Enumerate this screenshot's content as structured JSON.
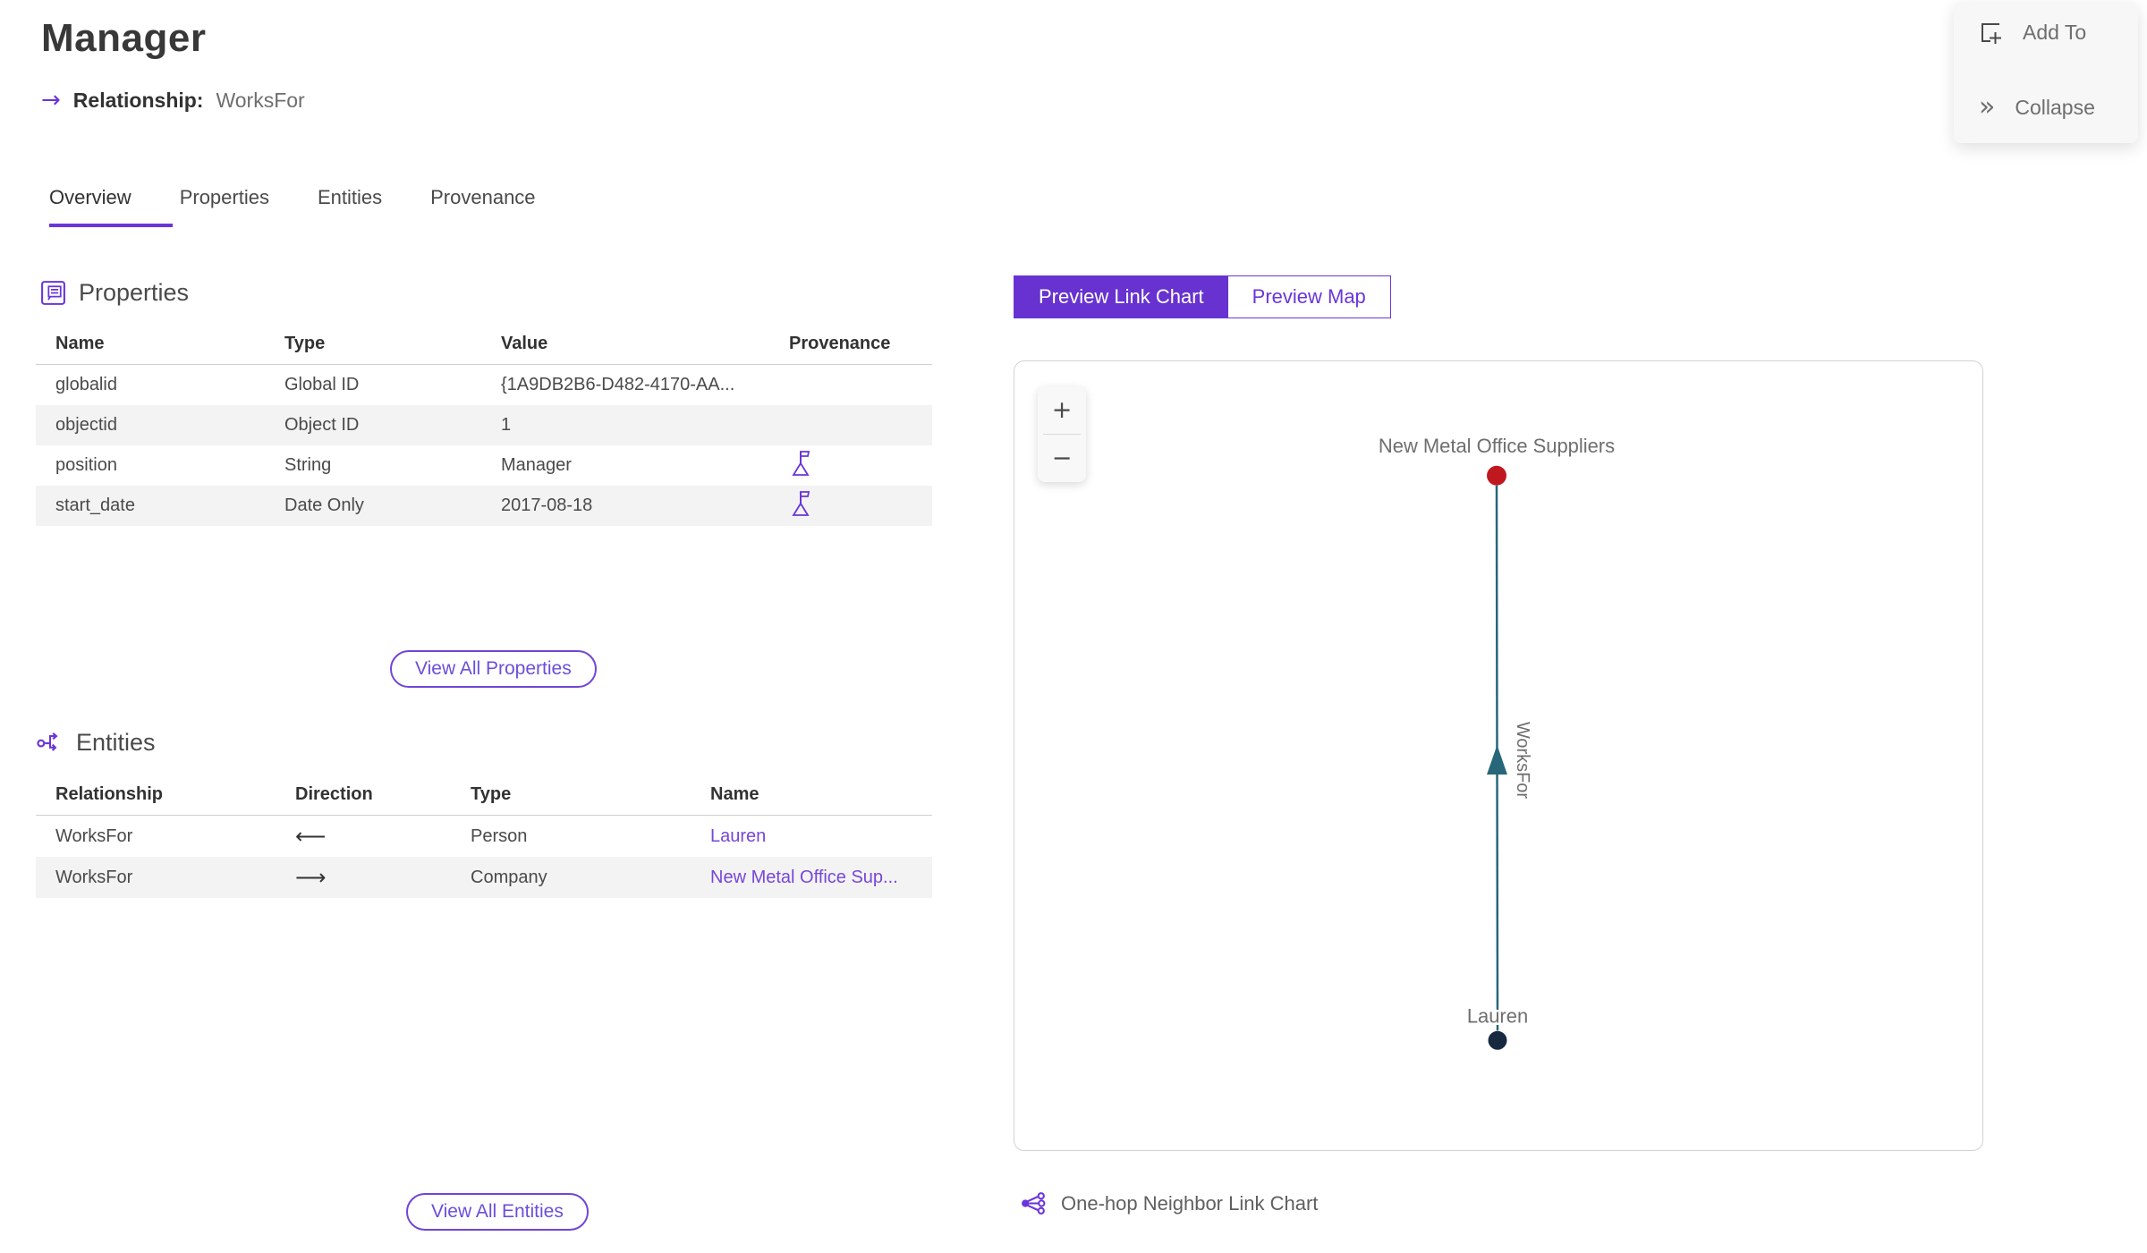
{
  "header": {
    "title": "Manager",
    "relationship_arrow": "→",
    "relationship_label": "Relationship:",
    "relationship_value": "WorksFor"
  },
  "actions": {
    "add_to_label": "Add To",
    "collapse_label": "Collapse",
    "collapse_glyph": "»"
  },
  "tabs": [
    {
      "label": "Overview",
      "active": true
    },
    {
      "label": "Properties",
      "active": false
    },
    {
      "label": "Entities",
      "active": false
    },
    {
      "label": "Provenance",
      "active": false
    }
  ],
  "properties": {
    "section_title": "Properties",
    "columns": {
      "name": "Name",
      "type": "Type",
      "value": "Value",
      "provenance": "Provenance"
    },
    "rows": [
      {
        "name": "globalid",
        "type": "Global ID",
        "value": "{1A9DB2B6-D482-4170-AA...",
        "provenance": false
      },
      {
        "name": "objectid",
        "type": "Object ID",
        "value": "1",
        "provenance": false
      },
      {
        "name": "position",
        "type": "String",
        "value": "Manager",
        "provenance": true
      },
      {
        "name": "start_date",
        "type": "Date Only",
        "value": "2017-08-18",
        "provenance": true
      }
    ],
    "view_all_label": "View All Properties"
  },
  "entities": {
    "section_title": "Entities",
    "columns": {
      "relationship": "Relationship",
      "direction": "Direction",
      "type": "Type",
      "name": "Name"
    },
    "rows": [
      {
        "relationship": "WorksFor",
        "direction_glyph": "⟵",
        "direction": "incoming",
        "type": "Person",
        "name": "Lauren"
      },
      {
        "relationship": "WorksFor",
        "direction_glyph": "⟶",
        "direction": "outgoing",
        "type": "Company",
        "name": "New Metal Office Sup..."
      }
    ],
    "view_all_label": "View All Entities"
  },
  "preview": {
    "link_chart_label": "Preview Link Chart",
    "map_label": "Preview Map",
    "zoom_in": "+",
    "zoom_out": "−",
    "caption": "One-hop Neighbor Link Chart"
  },
  "link_chart": {
    "type": "link-chart",
    "nodes": [
      {
        "label": "New Metal Office Suppliers",
        "entity_type": "Company",
        "color": "#c0181f",
        "position": "top"
      },
      {
        "label": "Lauren",
        "entity_type": "Person",
        "color": "#17293f",
        "position": "bottom"
      }
    ],
    "edges": [
      {
        "label": "WorksFor",
        "from": "Lauren",
        "to": "New Metal Office Suppliers",
        "color": "#266779",
        "arrow_direction": "up"
      }
    ]
  },
  "colors": {
    "accent": "#6a35d9",
    "active_button_bg": "#6732cf",
    "link": "#7646d9",
    "edge": "#266779",
    "node_company": "#c0181f",
    "node_person": "#17293f",
    "row_stripe": "#f3f3f3"
  }
}
